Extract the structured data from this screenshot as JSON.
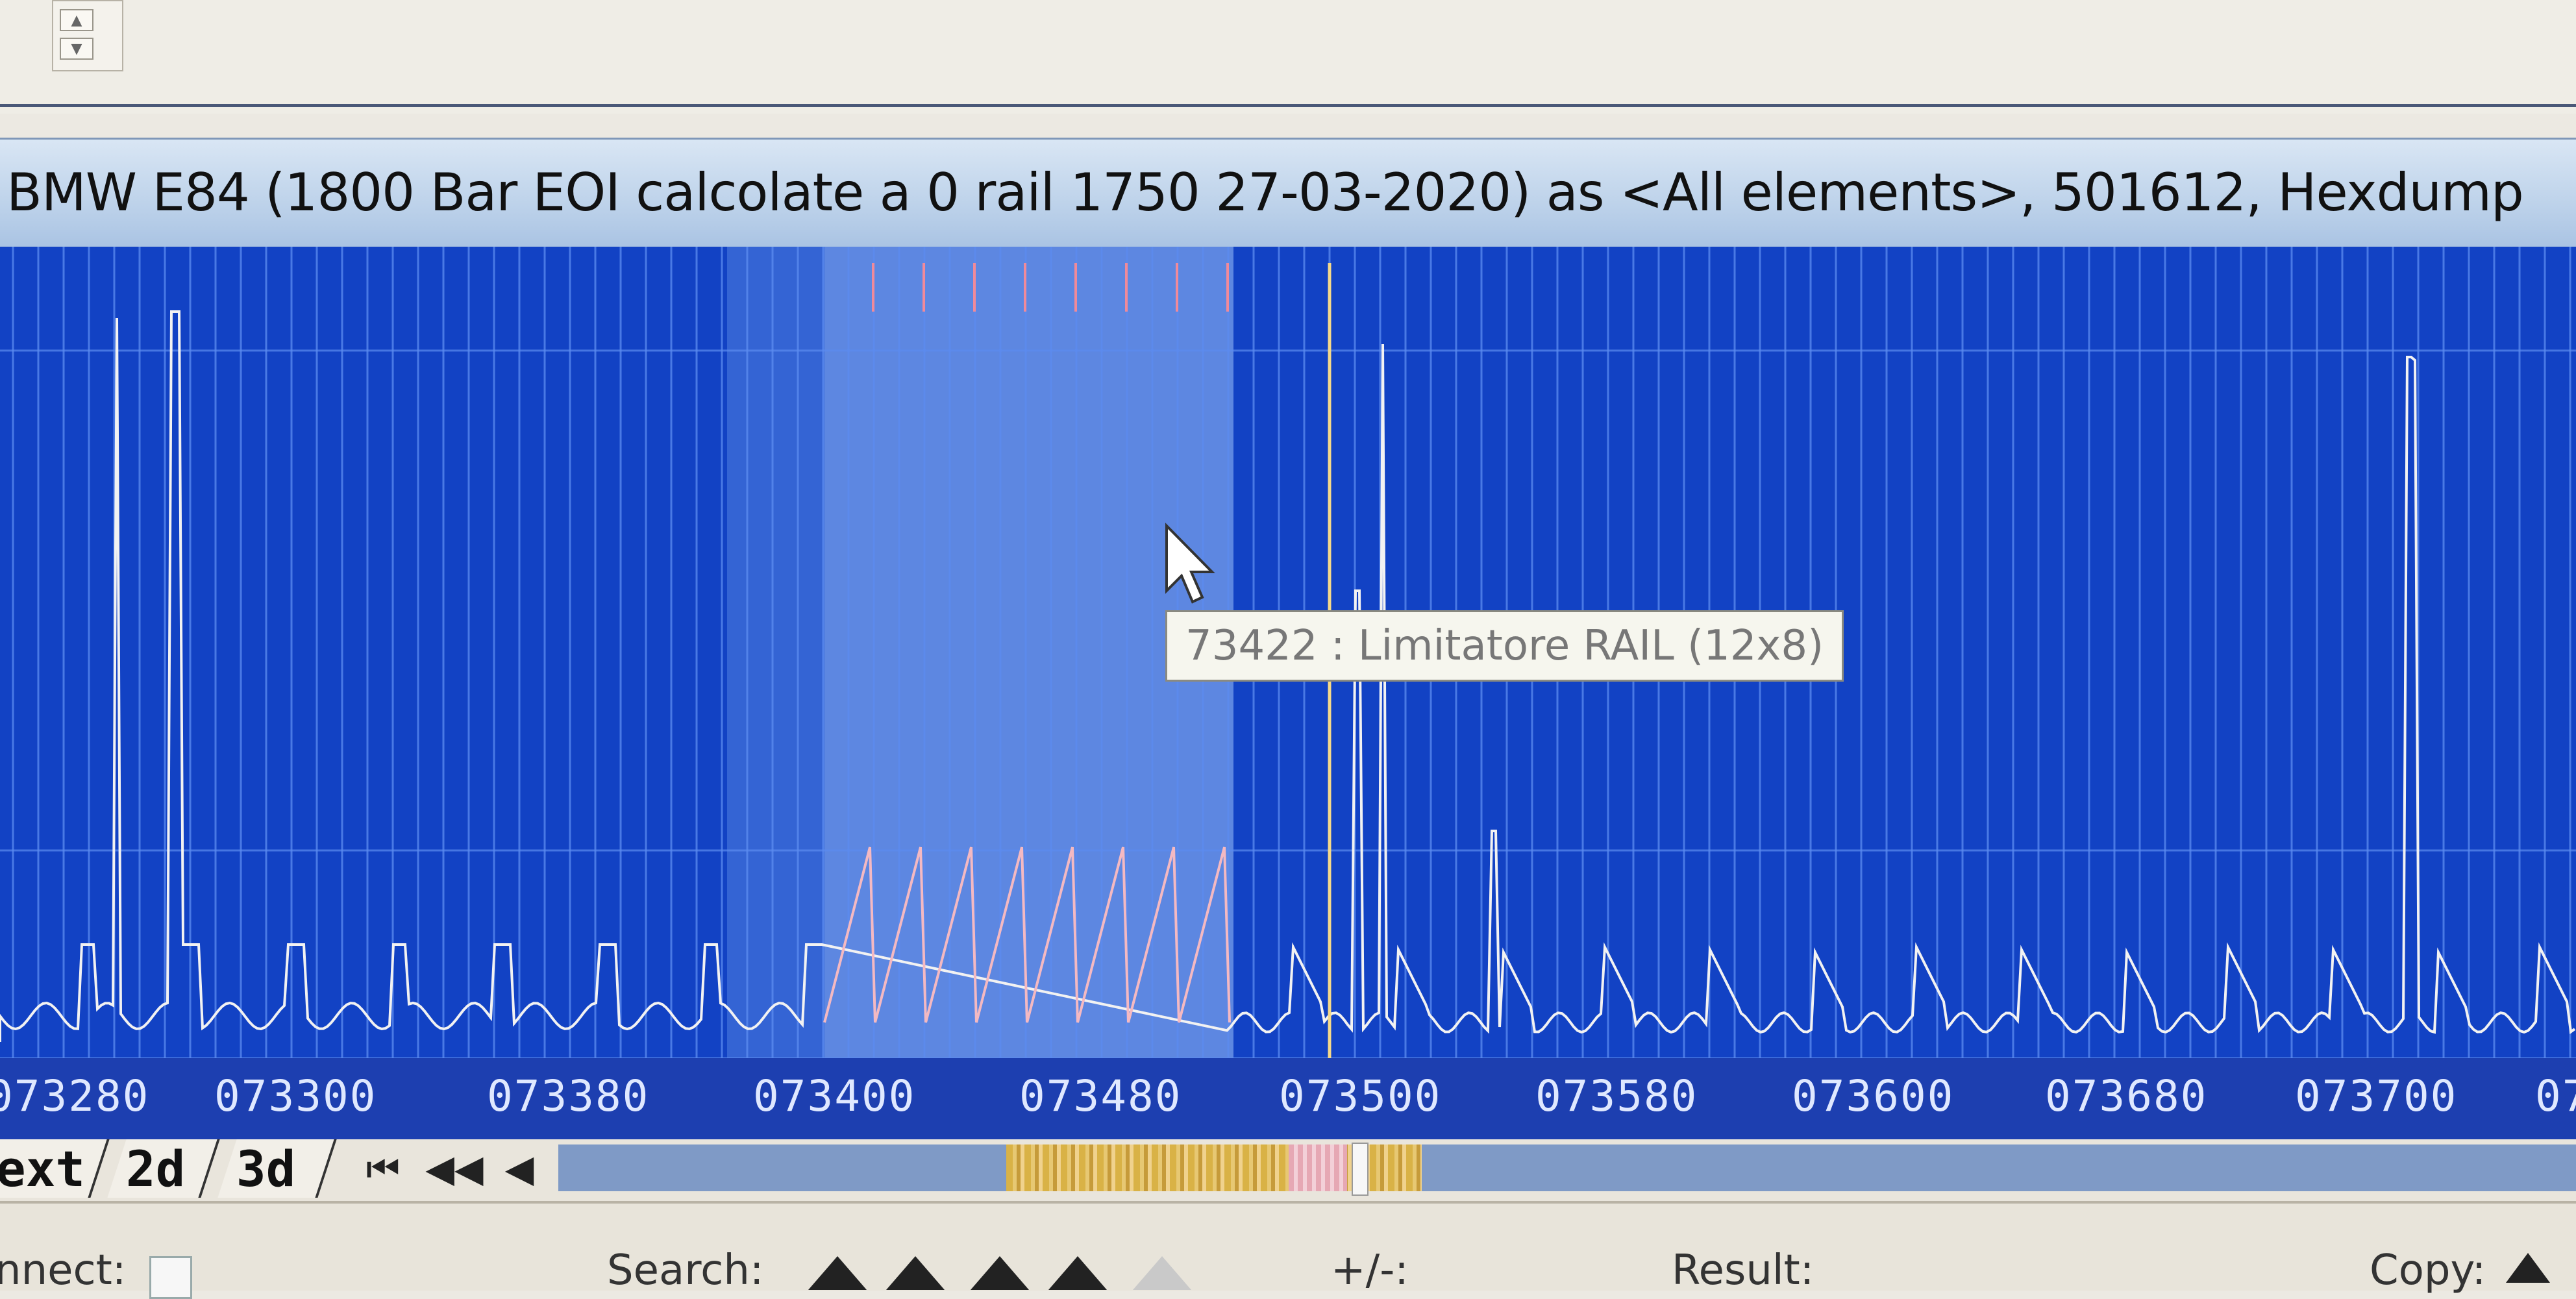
{
  "toolbar": {
    "spin_up_icon": "spin-up-arrow",
    "spin_down_icon": "spin-down-arrow"
  },
  "window": {
    "title": "BMW E84 (1800 Bar EOI calcolate a 0 rail 1750 27-03-2020) as <All elements>, 501612, Hexdump"
  },
  "graph": {
    "addresses": [
      "073280",
      "073300",
      "073380",
      "073400",
      "073480",
      "073500",
      "073580",
      "073600",
      "073680",
      "073700",
      "07"
    ],
    "tooltip": "73422 : Limitatore RAIL (12x8)",
    "colors": {
      "background": "#1242c4",
      "grid": "#5c8cf0",
      "trace": "#f2f2f2",
      "selected_trace": "#f4b9c2",
      "cursor_line": "#f5d98a"
    }
  },
  "tabs": [
    {
      "label": "ext"
    },
    {
      "label": "2d"
    },
    {
      "label": "3d"
    }
  ],
  "nav": {
    "first_icon": "skip-first-icon",
    "fast_back_icon": "fast-rewind-icon",
    "back_icon": "step-back-icon",
    "first_glyph": "⏮",
    "fast_back_glyph": "◀◀",
    "back_glyph": "◀"
  },
  "status": {
    "connect_label": "nnect:",
    "search_label": "Search:",
    "plusminus_label": "+/-:",
    "result_label": "Result:",
    "copy_label": "Copy:"
  }
}
